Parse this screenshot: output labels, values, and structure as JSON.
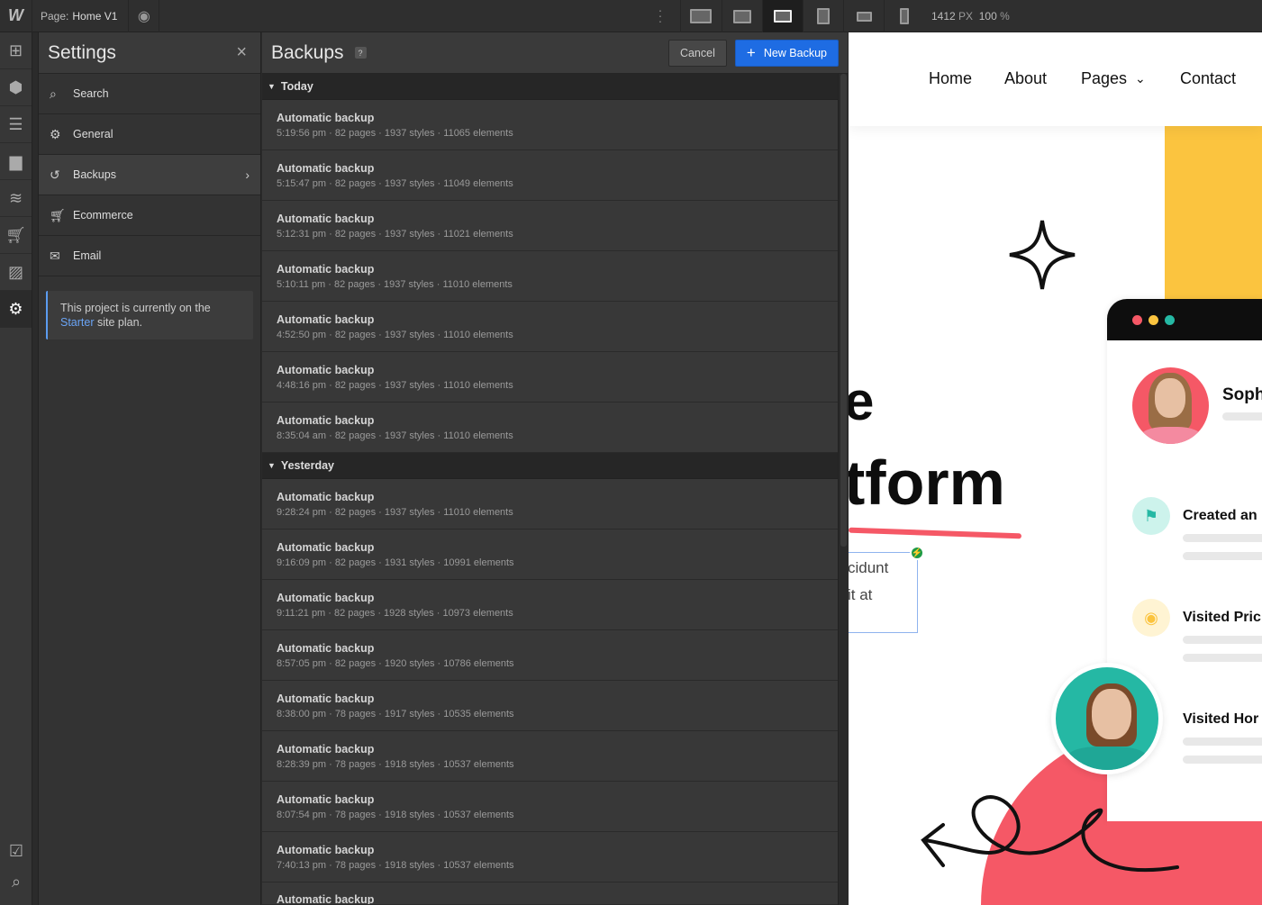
{
  "topbar": {
    "logo": "W",
    "page_prefix": "Page:",
    "page_name": "Home V1",
    "width_value": "1412",
    "width_unit": "PX",
    "zoom_value": "100",
    "zoom_unit": "%"
  },
  "settings": {
    "title": "Settings",
    "close_icon": "×",
    "items": [
      {
        "label": "Search",
        "icon": "search-icon"
      },
      {
        "label": "General",
        "icon": "gear-icon"
      },
      {
        "label": "Backups",
        "icon": "history-icon"
      },
      {
        "label": "Ecommerce",
        "icon": "cart-icon"
      },
      {
        "label": "Email",
        "icon": "envelope-icon"
      }
    ],
    "plan_text_before": "This project is currently on the",
    "plan_link": "Starter",
    "plan_text_after": "site plan."
  },
  "backups": {
    "title": "Backups",
    "help": "?",
    "cancel_label": "Cancel",
    "new_backup_label": "New Backup",
    "groups": [
      {
        "label": "Today",
        "items": [
          {
            "title": "Automatic backup",
            "meta": "5:19:56 pm · 82 pages · 1937 styles · 11065 elements"
          },
          {
            "title": "Automatic backup",
            "meta": "5:15:47 pm · 82 pages · 1937 styles · 11049 elements"
          },
          {
            "title": "Automatic backup",
            "meta": "5:12:31 pm · 82 pages · 1937 styles · 11021 elements"
          },
          {
            "title": "Automatic backup",
            "meta": "5:10:11 pm · 82 pages · 1937 styles · 11010 elements"
          },
          {
            "title": "Automatic backup",
            "meta": "4:52:50 pm · 82 pages · 1937 styles · 11010 elements"
          },
          {
            "title": "Automatic backup",
            "meta": "4:48:16 pm · 82 pages · 1937 styles · 11010 elements"
          },
          {
            "title": "Automatic backup",
            "meta": "8:35:04 am · 82 pages · 1937 styles · 11010 elements"
          }
        ]
      },
      {
        "label": "Yesterday",
        "items": [
          {
            "title": "Automatic backup",
            "meta": "9:28:24 pm · 82 pages · 1937 styles · 11010 elements"
          },
          {
            "title": "Automatic backup",
            "meta": "9:16:09 pm · 82 pages · 1931 styles · 10991 elements"
          },
          {
            "title": "Automatic backup",
            "meta": "9:11:21 pm · 82 pages · 1928 styles · 10973 elements"
          },
          {
            "title": "Automatic backup",
            "meta": "8:57:05 pm · 82 pages · 1920 styles · 10786 elements"
          },
          {
            "title": "Automatic backup",
            "meta": "8:38:00 pm · 78 pages · 1917 styles · 10535 elements"
          },
          {
            "title": "Automatic backup",
            "meta": "8:28:39 pm · 78 pages · 1918 styles · 10537 elements"
          },
          {
            "title": "Automatic backup",
            "meta": "8:07:54 pm · 78 pages · 1918 styles · 10537 elements"
          },
          {
            "title": "Automatic backup",
            "meta": "7:40:13 pm · 78 pages · 1918 styles · 10537 elements"
          },
          {
            "title": "Automatic backup",
            "meta": ""
          }
        ]
      }
    ]
  },
  "canvas": {
    "nav": [
      "Home",
      "About",
      "Pages",
      "Contact"
    ],
    "hero_line1": "e",
    "hero_line2": "tform",
    "body_line1": "cidunt",
    "body_line2": "it at",
    "card_name": "Soph",
    "activity": [
      "Created an",
      "Visited Pric",
      "Visited Hor"
    ],
    "colors": {
      "accent": "#1e6ce3",
      "red": "#f55866",
      "yellow": "#fbc43f",
      "teal": "#25b8a4"
    }
  }
}
